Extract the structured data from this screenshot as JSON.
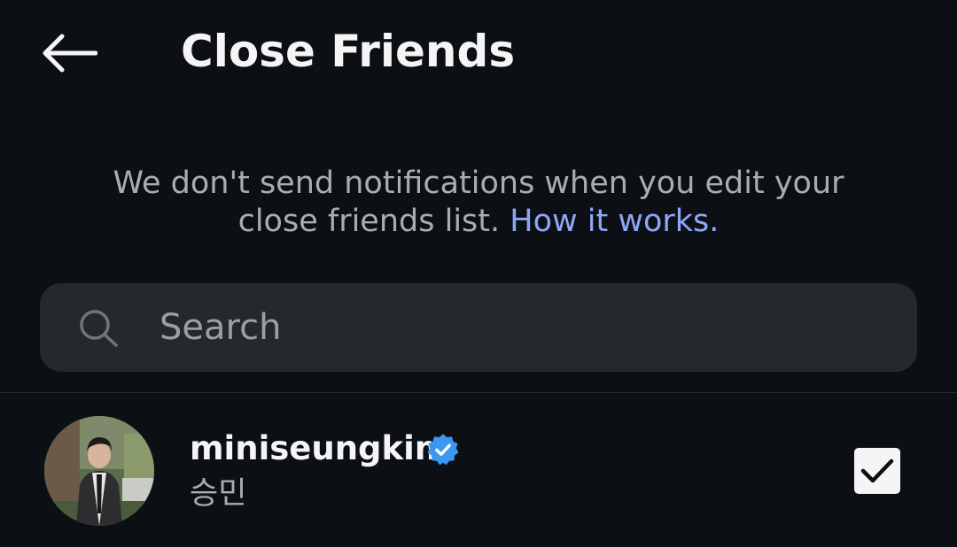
{
  "header": {
    "title": "Close Friends",
    "back_icon": "arrow-left-icon"
  },
  "notice": {
    "text": "We don't send notifications when you edit your close friends list.",
    "link": "How it works."
  },
  "search": {
    "placeholder": "Search",
    "icon": "search-icon"
  },
  "friends": [
    {
      "username": "miniseungkim",
      "full_name": "승민",
      "verified": true,
      "selected": true
    }
  ],
  "colors": {
    "background": "#0c1014",
    "link": "#8ea6f8",
    "verified_badge": "#3b97f0",
    "search_bg": "#25292e"
  }
}
